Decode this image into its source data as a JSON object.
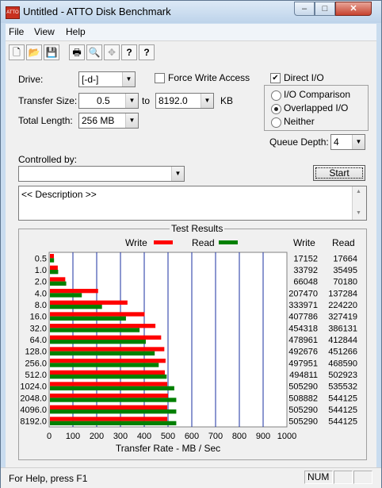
{
  "window": {
    "title": "Untitled - ATTO Disk Benchmark",
    "app_icon_label": "ATTO",
    "minimize": "–",
    "maximize": "□",
    "close": "✕"
  },
  "menu": [
    "File",
    "View",
    "Help"
  ],
  "toolbar": {
    "new": "🗋",
    "open": "📂",
    "save": "💾",
    "print": "🖶",
    "preview": "🔍",
    "move": "✥",
    "help": "?",
    "context_help": "?"
  },
  "settings": {
    "drive_label": "Drive:",
    "drive_value": "[-d-]",
    "force_write_label": "Force Write Access",
    "force_write_checked": false,
    "direct_io_label": "Direct I/O",
    "direct_io_checked": true,
    "transfer_size_label": "Transfer Size:",
    "transfer_from": "0.5",
    "to_label": "to",
    "transfer_to": "8192.0",
    "kb_label": "KB",
    "total_length_label": "Total Length:",
    "total_length_value": "256 MB",
    "io_comparison_label": "I/O Comparison",
    "overlapped_io_label": "Overlapped I/O",
    "neither_label": "Neither",
    "selected_mode": "Overlapped I/O",
    "queue_depth_label": "Queue Depth:",
    "queue_depth_value": "4",
    "controlled_by_label": "Controlled by:",
    "controlled_by_value": "",
    "start_label": "Start",
    "description": "<< Description >>"
  },
  "results": {
    "title": "Test Results",
    "write_col": "Write",
    "read_col": "Read",
    "legend_write": "Write",
    "legend_read": "Read",
    "x_axis_label": "Transfer Rate - MB / Sec"
  },
  "chart_data": {
    "type": "bar",
    "orientation": "horizontal",
    "categories": [
      "0.5",
      "1.0",
      "2.0",
      "4.0",
      "8.0",
      "16.0",
      "32.0",
      "64.0",
      "128.0",
      "256.0",
      "512.0",
      "1024.0",
      "2048.0",
      "4096.0",
      "8192.0"
    ],
    "series": [
      {
        "name": "Write",
        "color": "#ff0000",
        "values": [
          17152,
          33792,
          66048,
          207470,
          333971,
          407786,
          454318,
          478961,
          492676,
          497951,
          494811,
          505290,
          508882,
          505290,
          505290
        ]
      },
      {
        "name": "Read",
        "color": "#008000",
        "values": [
          17664,
          35495,
          70180,
          137284,
          224220,
          327419,
          386131,
          412844,
          451266,
          468590,
          502923,
          535532,
          544125,
          544125,
          544125
        ]
      }
    ],
    "x_ticks": [
      "0",
      "100",
      "200",
      "300",
      "400",
      "500",
      "600",
      "700",
      "800",
      "900",
      "1000"
    ],
    "xlim": [
      0,
      1000
    ],
    "xlabel": "Transfer Rate - MB / Sec",
    "grid": true,
    "legend": "top"
  },
  "status": {
    "message": "For Help, press F1",
    "num": "NUM"
  }
}
